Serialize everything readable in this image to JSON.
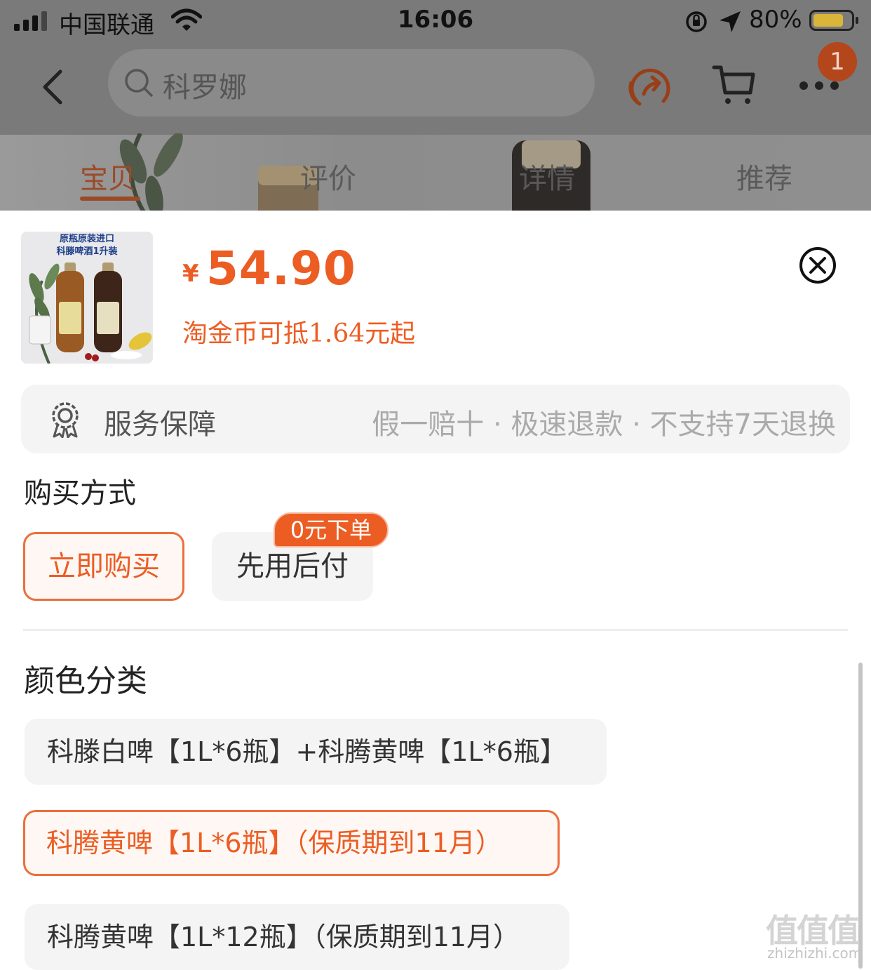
{
  "status_bar": {
    "carrier": "中国联通",
    "time": "16:06",
    "battery": "80%",
    "battery_level": 0.8
  },
  "top_nav": {
    "search_text": "科罗娜",
    "cart_badge": "1"
  },
  "tabs": [
    {
      "label": "宝贝",
      "active": true
    },
    {
      "label": "评价",
      "active": false
    },
    {
      "label": "详情",
      "active": false
    },
    {
      "label": "推荐",
      "active": false
    }
  ],
  "product": {
    "thumb_caption_line1": "原瓶原装进口",
    "thumb_caption_line2": "科滕啤酒1升装",
    "currency": "¥",
    "price": "54.90",
    "coin_note": "淘金币可抵1.64元起"
  },
  "service": {
    "title": "服务保障",
    "detail": "假一赔十 · 极速退款 · 不支持7天退换"
  },
  "purchase": {
    "heading": "购买方式",
    "options": [
      "立即购买",
      "先用后付"
    ],
    "tag": "0元下单",
    "selected_index": 0
  },
  "color": {
    "heading": "颜色分类",
    "skus": [
      "科滕白啤【1L*6瓶】+科腾黄啤【1L*6瓶】",
      "科腾黄啤【1L*6瓶】（保质期到11月）",
      "科腾黄啤【1L*12瓶】（保质期到11月）"
    ],
    "selected_index": 1
  },
  "watermark": {
    "big": "值值值",
    "small": "zhizhizhi.com"
  },
  "colors": {
    "accent": "#ec5d23",
    "overlay": "#7a7a7a",
    "chip_bg": "#f4f4f4"
  }
}
